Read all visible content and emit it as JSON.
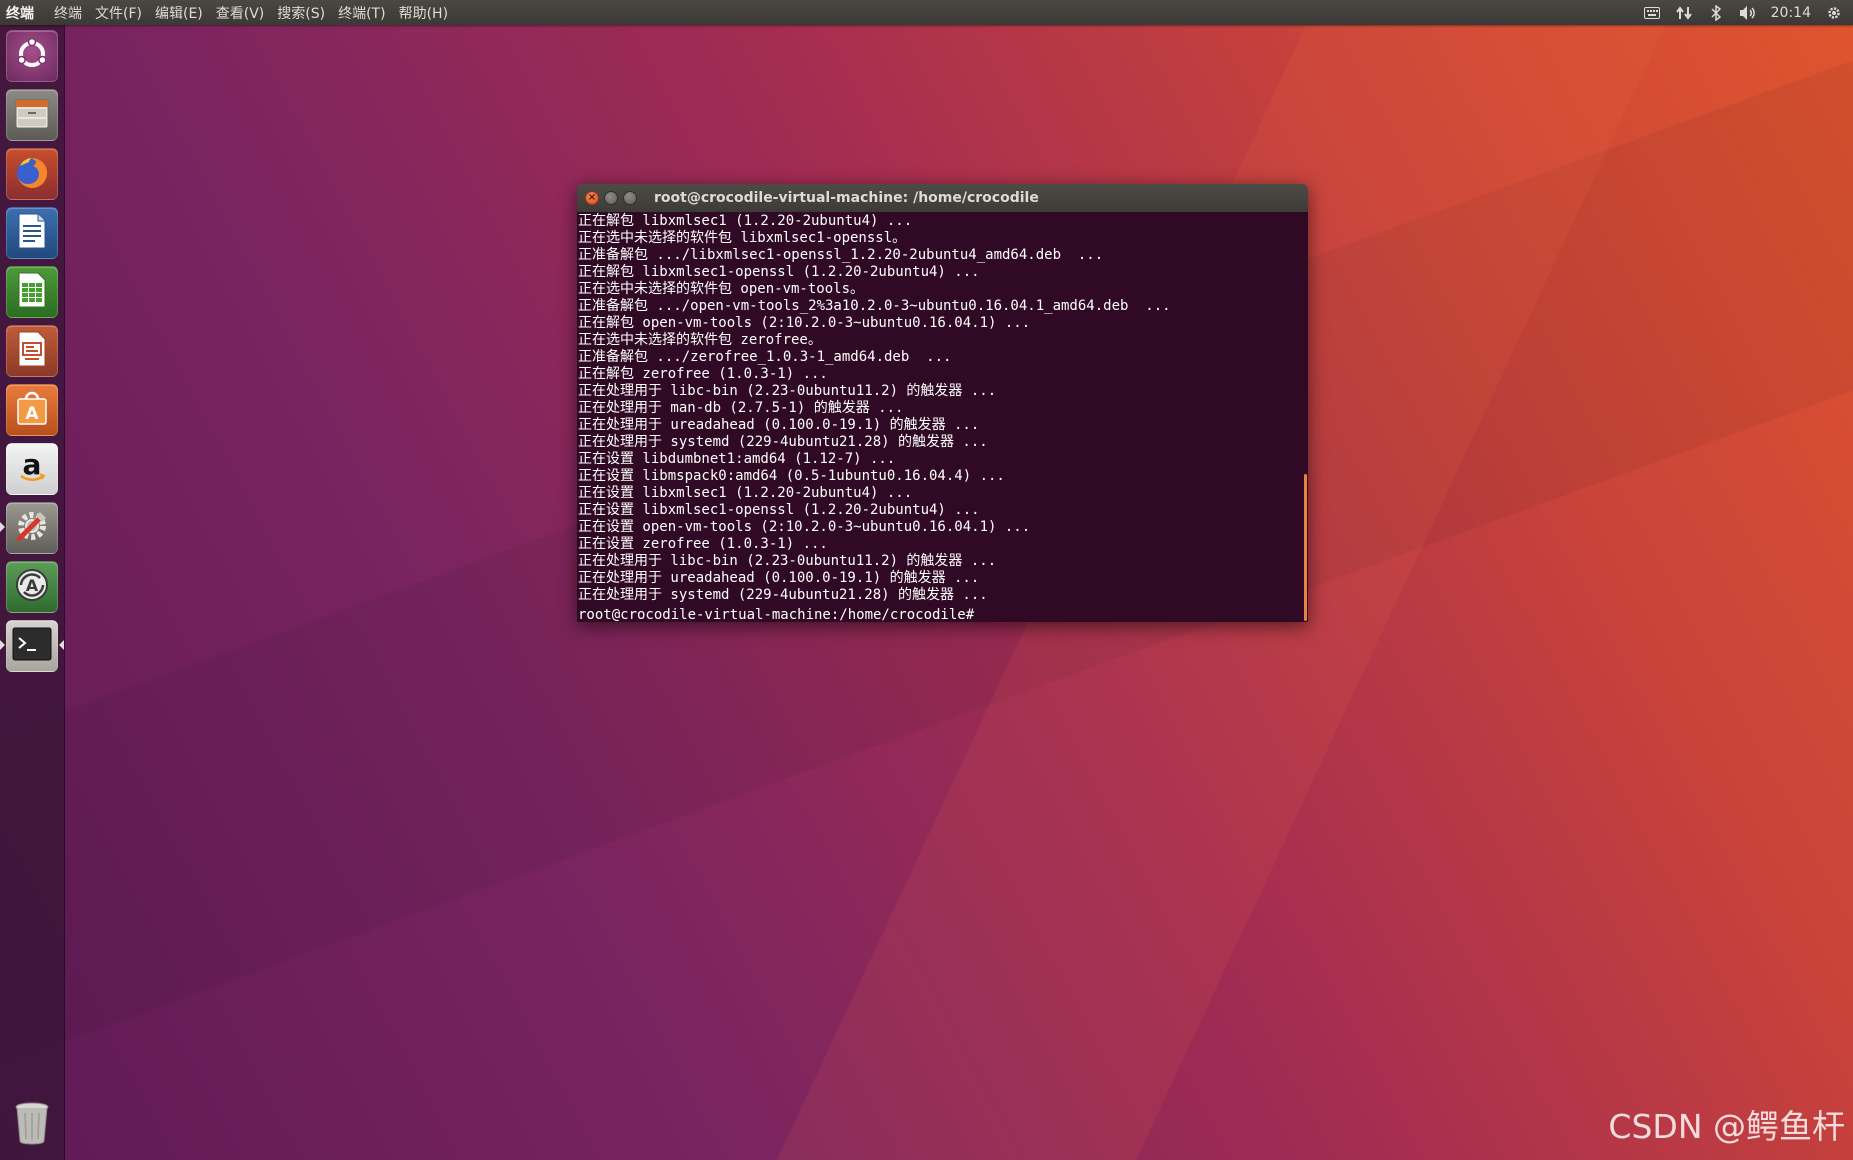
{
  "top_panel": {
    "app_name": "终端",
    "menus": [
      "终端",
      "文件(F)",
      "编辑(E)",
      "查看(V)",
      "搜索(S)",
      "终端(T)",
      "帮助(H)"
    ],
    "indicators": {
      "keyboard_icon": "keyboard-icon",
      "network_icon": "network-arrows-icon",
      "bluetooth_icon": "bluetooth-icon",
      "volume_icon": "volume-icon",
      "clock": "20:14",
      "settings_icon": "gear-icon"
    }
  },
  "launcher": {
    "items": [
      {
        "name": "dash-home",
        "icon": "ubuntu-logo-icon"
      },
      {
        "name": "files",
        "icon": "file-cabinet-icon"
      },
      {
        "name": "firefox",
        "icon": "firefox-icon"
      },
      {
        "name": "libreoffice-writer",
        "icon": "writer-document-icon"
      },
      {
        "name": "libreoffice-calc",
        "icon": "calc-spreadsheet-icon"
      },
      {
        "name": "libreoffice-impress",
        "icon": "impress-presentation-icon"
      },
      {
        "name": "ubuntu-software",
        "icon": "software-bag-icon"
      },
      {
        "name": "amazon",
        "icon": "amazon-icon"
      },
      {
        "name": "system-settings",
        "icon": "settings-tools-icon"
      },
      {
        "name": "software-updater",
        "icon": "updater-icon"
      },
      {
        "name": "terminal",
        "icon": "terminal-icon",
        "label": ">_"
      },
      {
        "name": "trash",
        "icon": "trash-icon"
      }
    ]
  },
  "terminal": {
    "title": "root@crocodile-virtual-machine: /home/crocodile",
    "lines": [
      "正在解包 libxmlsec1 (1.2.20-2ubuntu4) ...",
      "正在选中未选择的软件包 libxmlsec1-openssl。",
      "正准备解包 .../libxmlsec1-openssl_1.2.20-2ubuntu4_amd64.deb  ...",
      "正在解包 libxmlsec1-openssl (1.2.20-2ubuntu4) ...",
      "正在选中未选择的软件包 open-vm-tools。",
      "正准备解包 .../open-vm-tools_2%3a10.2.0-3~ubuntu0.16.04.1_amd64.deb  ...",
      "正在解包 open-vm-tools (2:10.2.0-3~ubuntu0.16.04.1) ...",
      "正在选中未选择的软件包 zerofree。",
      "正准备解包 .../zerofree_1.0.3-1_amd64.deb  ...",
      "正在解包 zerofree (1.0.3-1) ...",
      "正在处理用于 libc-bin (2.23-0ubuntu11.2) 的触发器 ...",
      "正在处理用于 man-db (2.7.5-1) 的触发器 ...",
      "正在处理用于 ureadahead (0.100.0-19.1) 的触发器 ...",
      "正在处理用于 systemd (229-4ubuntu21.28) 的触发器 ...",
      "正在设置 libdumbnet1:amd64 (1.12-7) ...",
      "正在设置 libmspack0:amd64 (0.5-1ubuntu0.16.04.4) ...",
      "正在设置 libxmlsec1 (1.2.20-2ubuntu4) ...",
      "正在设置 libxmlsec1-openssl (1.2.20-2ubuntu4) ...",
      "正在设置 open-vm-tools (2:10.2.0-3~ubuntu0.16.04.1) ...",
      "正在设置 zerofree (1.0.3-1) ...",
      "正在处理用于 libc-bin (2.23-0ubuntu11.2) 的触发器 ...",
      "正在处理用于 ureadahead (0.100.0-19.1) 的触发器 ...",
      "正在处理用于 systemd (229-4ubuntu21.28) 的触发器 ..."
    ],
    "prompt": "root@crocodile-virtual-machine:/home/crocodile#"
  },
  "watermark": "CSDN @鳄鱼杆",
  "colors": {
    "terminal_bg": "#300a24",
    "close_button": "#df4a16",
    "scrollbar": "#e8843f",
    "panel_bg": "#3c3b37"
  }
}
